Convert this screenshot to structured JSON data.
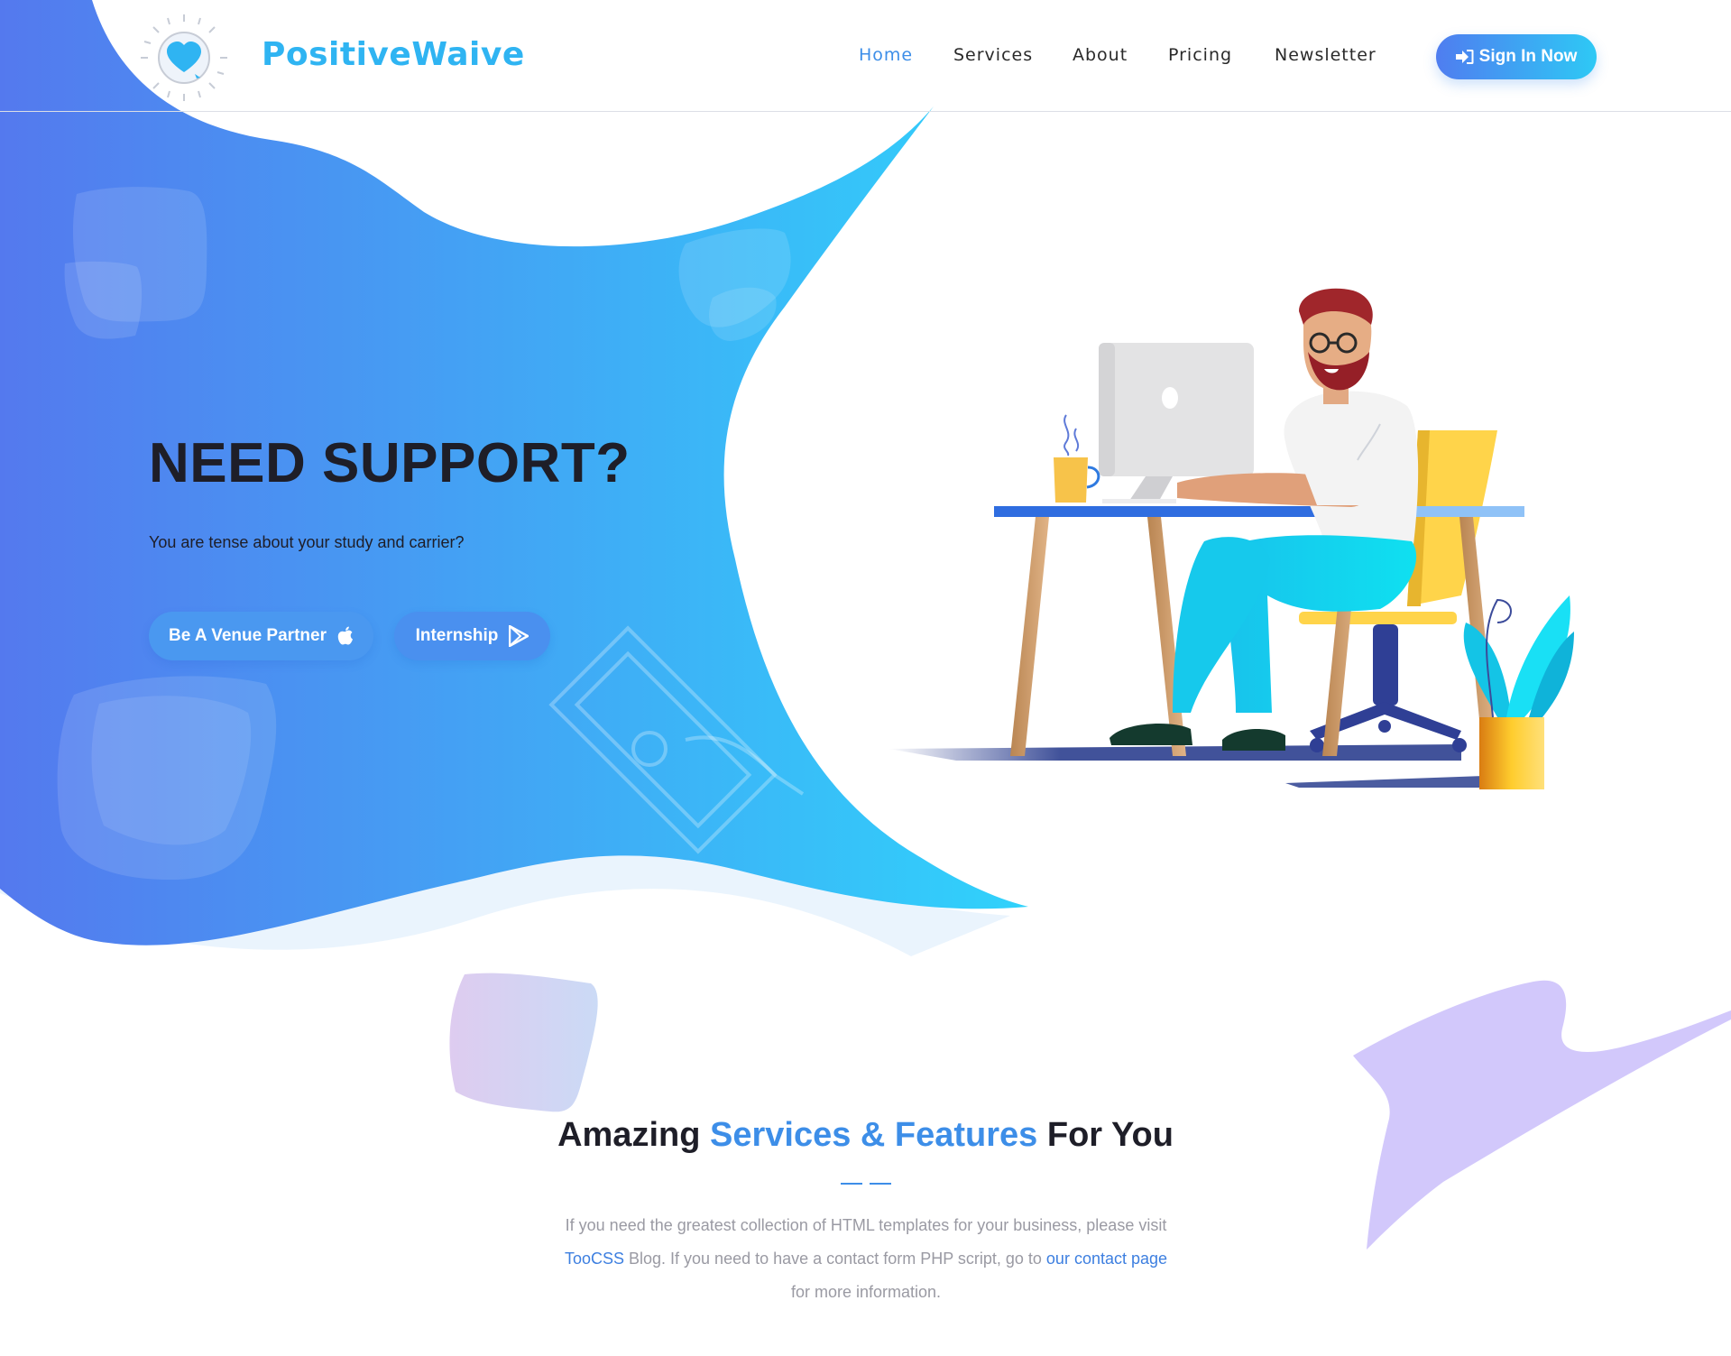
{
  "brand": {
    "name": "PositiveWaive",
    "logo_icon": "heart-bulb-icon",
    "color": "#2fb4f2"
  },
  "nav": {
    "items": [
      {
        "label": "Home",
        "active": true
      },
      {
        "label": "Services",
        "active": false
      },
      {
        "label": "About",
        "active": false
      },
      {
        "label": "Pricing",
        "active": false
      },
      {
        "label": "Newsletter",
        "active": false
      }
    ],
    "active_color": "#3d8ee8",
    "signin": {
      "label": "Sign In Now",
      "icon": "sign-in-icon"
    }
  },
  "hero": {
    "title": "NEED SUPPORT?",
    "subtitle": "You are tense about your study and carrier?",
    "buttons": [
      {
        "label": "Be A Venue Partner",
        "icon": "apple-icon"
      },
      {
        "label": "Internship",
        "icon": "play-store-icon"
      }
    ],
    "gradient": [
      "#5479ee",
      "#30d2fb"
    ],
    "illustration": "man-working-at-desk-illustration"
  },
  "section": {
    "title_prefix": "Amazing ",
    "title_accent": "Services & Features",
    "title_suffix": " For You",
    "body_1": "If you need the greatest collection of HTML templates for your business, please visit",
    "link_1": "TooCSS",
    "body_2": " Blog. If you need to have a contact form PHP script, go to ",
    "link_2": "our contact page",
    "body_3": "for more information."
  }
}
